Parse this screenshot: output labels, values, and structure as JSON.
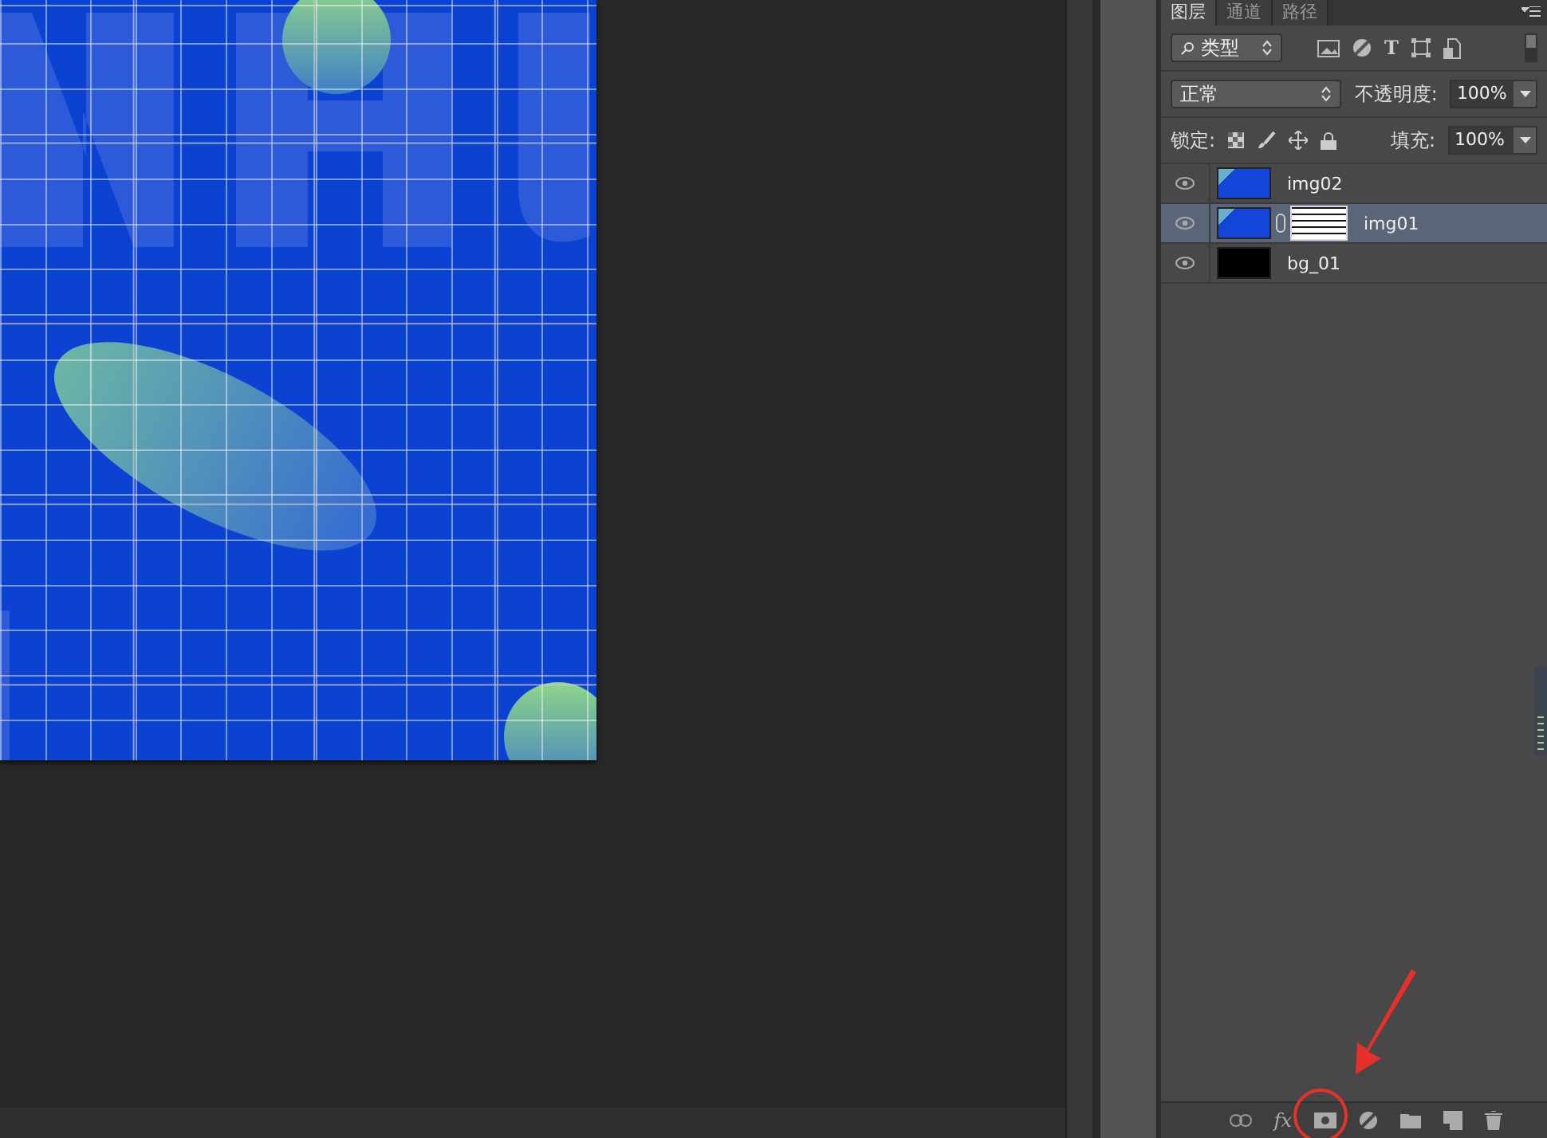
{
  "tabs": [
    {
      "label": "图层",
      "selected": true
    },
    {
      "label": "通道",
      "selected": false
    },
    {
      "label": "路径",
      "selected": false
    }
  ],
  "filter": {
    "value": "类型",
    "type_icon": "T"
  },
  "blend_mode": {
    "value": "正常"
  },
  "opacity": {
    "label": "不透明度:",
    "value": "100%"
  },
  "lock": {
    "label": "锁定:"
  },
  "fill": {
    "label": "填充:",
    "value": "100%"
  },
  "layers": [
    {
      "name": "img02",
      "visible": true,
      "selected": false,
      "kind": "image"
    },
    {
      "name": "img01",
      "visible": true,
      "selected": true,
      "kind": "masked"
    },
    {
      "name": "bg_01",
      "visible": true,
      "selected": false,
      "kind": "solid"
    }
  ],
  "footer": {
    "fx": "fx"
  }
}
